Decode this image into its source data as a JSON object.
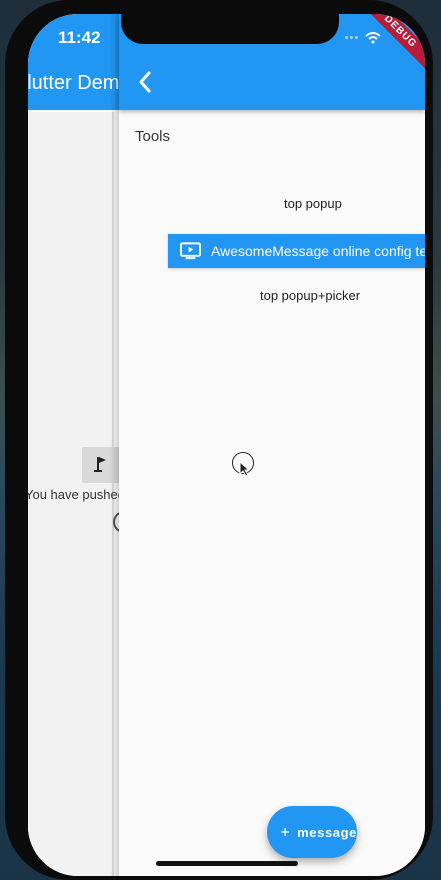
{
  "status": {
    "time": "11:42"
  },
  "back_route": {
    "title": "Flutter Demo",
    "text": "You have pushed the",
    "button_icon": "flag-icon"
  },
  "appbar": {
    "back_icon": "chevron-left-icon"
  },
  "debug_banner": "DEBUG",
  "section": {
    "title": "Tools"
  },
  "buttons": {
    "top_popup": "top popup",
    "online_config": "AwesomeMessage online config test",
    "top_popup_picker": "top popup+picker"
  },
  "fab": {
    "label": "message",
    "icon": "plus-icon"
  },
  "colors": {
    "primary": "#2196f3",
    "debug": "#b71c3a"
  }
}
